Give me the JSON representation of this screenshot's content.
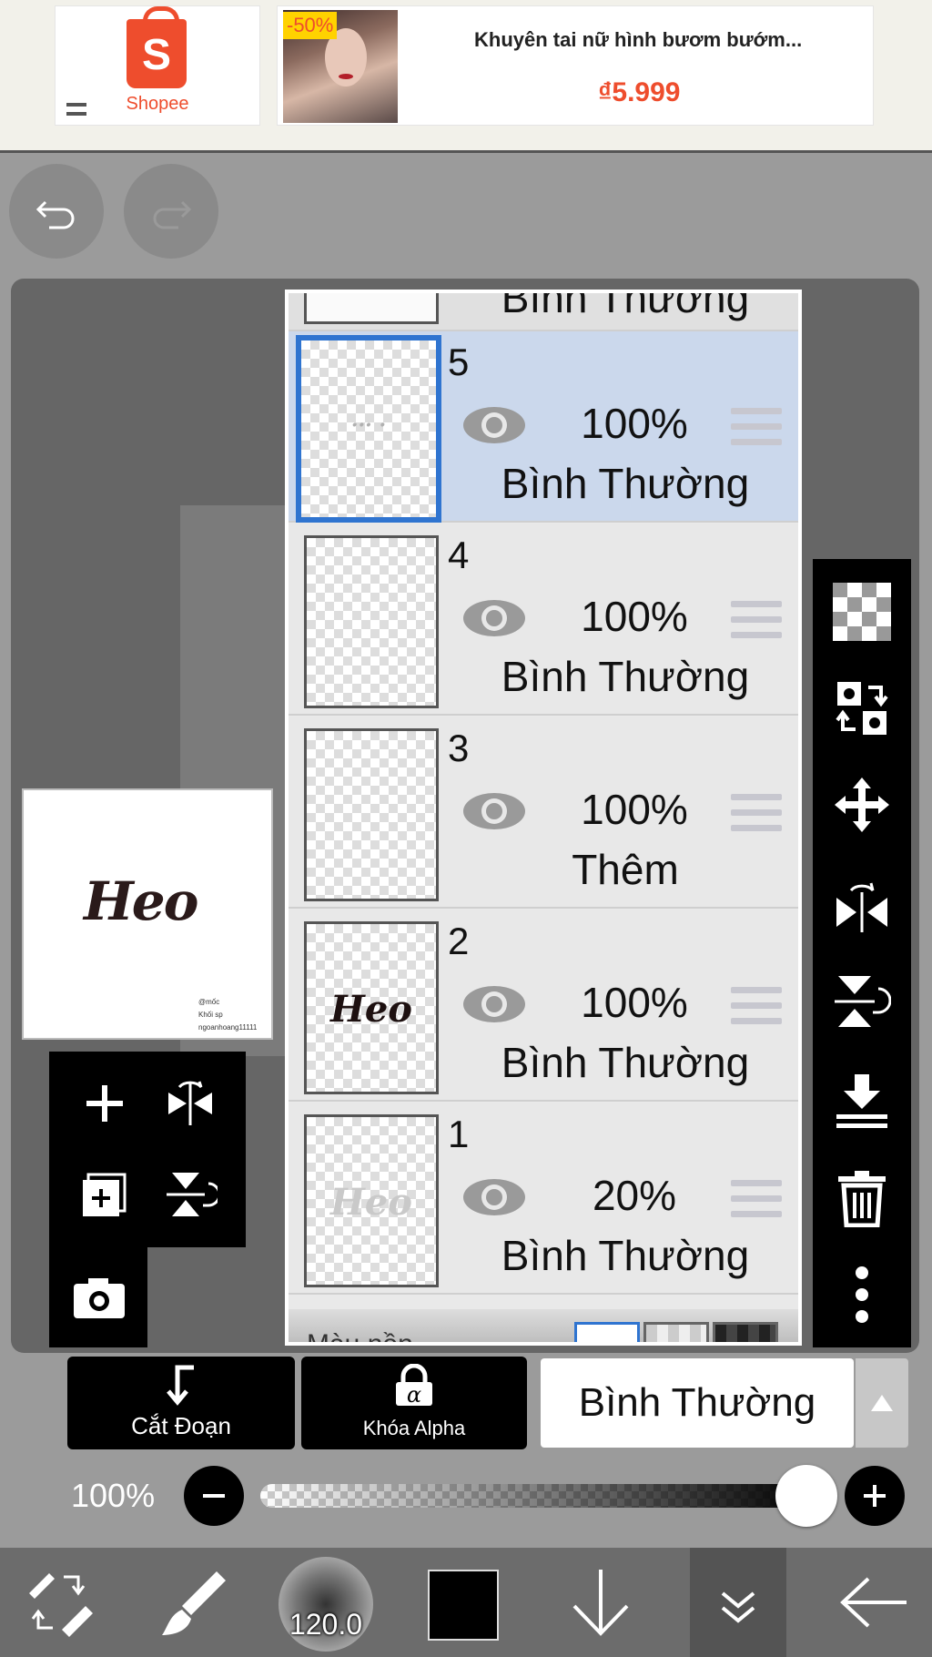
{
  "ad": {
    "brand": "Shopee",
    "brand_letter": "S",
    "discount": "-50%",
    "product_title": "Khuyên tai nữ hình bươm bướm...",
    "price": "₫5.999",
    "accent_color": "#ee4d2d"
  },
  "canvas": {
    "preview_text": "Heo",
    "preview_credit": [
      "@mốc",
      "Khối sp",
      "ngoanhoang11111"
    ]
  },
  "layers": {
    "top_partial_blend": "Bình Thường",
    "items": [
      {
        "num": "5",
        "opacity": "100%",
        "blend": "Bình Thường",
        "selected": true,
        "thumb": "··· ·"
      },
      {
        "num": "4",
        "opacity": "100%",
        "blend": "Bình Thường",
        "selected": false,
        "thumb": ""
      },
      {
        "num": "3",
        "opacity": "100%",
        "blend": "Thêm",
        "selected": false,
        "thumb": ""
      },
      {
        "num": "2",
        "opacity": "100%",
        "blend": "Bình Thường",
        "selected": false,
        "thumb": "Heo"
      },
      {
        "num": "1",
        "opacity": "20%",
        "blend": "Bình Thường",
        "selected": false,
        "thumb": "Heo"
      }
    ],
    "bottom_label": "Màu nền"
  },
  "actions": {
    "clip_label": "Cắt Đoạn",
    "alpha_label": "Khóa Alpha",
    "blend_mode": "Bình Thường"
  },
  "opacity_slider": {
    "label": "100%",
    "value_fraction": 1.0
  },
  "bottom_nav": {
    "brush_size": "120.0",
    "color": "#000000"
  },
  "icons": {
    "undo": "undo-icon",
    "redo": "redo-icon",
    "add_layer": "plus-icon",
    "flip_h": "flip-horizontal-icon",
    "add_copy": "duplicate-icon",
    "flip_v": "flip-vertical-icon",
    "camera": "camera-icon",
    "transparency": "checkerboard-icon",
    "swap": "swap-icon",
    "move": "move-icon",
    "merge_down": "merge-down-icon",
    "trash": "trash-icon",
    "more": "more-vertical-icon"
  }
}
